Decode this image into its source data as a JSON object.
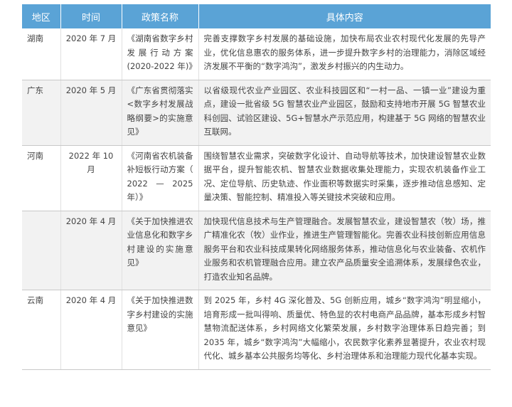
{
  "header": {
    "region": "地区",
    "time": "时间",
    "policy_name": "政策名称",
    "content": "具体内容"
  },
  "rows": [
    {
      "region": "湖南",
      "time": "2020 年 7 月",
      "policy_name": "《湖南省数字乡村发展行动方案(2020-2022 年)》",
      "content": "完善支撑数字乡村发展的基础设施，加快布局农业农村现代化发展的先导产业，优化信息惠农的服务体系，进一步提升数字乡村的治理能力，消除区域经济发展不平衡的“数字鸿沟”，激发乡村振兴的内生动力。"
    },
    {
      "region": "广东",
      "time": "2020 年 5 月",
      "policy_name": "《广东省贯彻落实<数字乡村发展战略纲要>的实施意见》",
      "content": "以省级现代农业产业园区、农业科技园区和“一村一品、一镇一业”建设为重点，建设一批省级 5G 智慧农业产业园区，鼓励和支持地市开展 5G 智慧农业科创园、试验区建设、5G+智慧水产示范应用，构建基于 5G 网络的智慧农业互联网。"
    },
    {
      "region": "河南",
      "time": "2022 年 10 月",
      "policy_name": "《河南省农机装备补短板行动方案（ 2022 — 2025 年）》",
      "content": "围绕智慧农业需求，突破数字化设计、自动导航等技术，加快建设智慧农业数据平台，提升智能农机、智慧农业数据收集处理能力，实现农机装备作业工况、定位导航、历史轨迹、作业面积等数据实时采集，逐步推动信息感知、定量决策、智能控制、精准投入等关键技术突破和应用。"
    },
    {
      "region": "",
      "time": "2020 年 4 月",
      "policy_name": "《关于加快推进农业信息化和数字乡村建设的实施意见》",
      "content": "加快现代信息技术与生产管理融合。发展智慧农业，建设智慧农（牧）场，推广精准化农（牧）业作业，推进生产管理智能化。完善农业科技创新应用信息服务平台和农业科技成果转化网络服务体系，推动信息化与农业装备、农机作业服务和农机管理融合应用。建立农产品质量安全追溯体系，发展绿色农业，打造农业知名品牌。"
    },
    {
      "region": "云南",
      "time": "2020 年 4 月",
      "policy_name": "《关于加快推进数字乡村建设的实施意见》",
      "content": "到 2025 年，乡村 4G 深化普及、5G 创新应用，城乡“数字鸿沟”明显缩小，培育形成一批叫得响、质量优、特色显的农村电商产品品牌，基本形成乡村智慧物流配送体系，乡村网络文化繁荣发展，乡村数字治理体系日趋完善；到 2035 年，城乡“数字鸿沟”大幅缩小，农民数字化素养显著提升，农业农村现代化、城乡基本公共服务均等化、乡村治理体系和治理能力现代化基本实现。"
    }
  ]
}
